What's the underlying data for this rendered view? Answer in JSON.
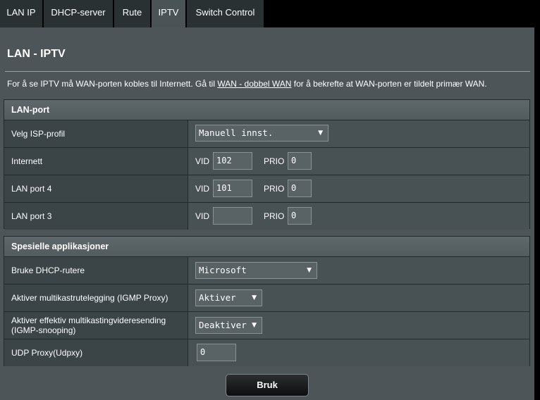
{
  "tabs": [
    "LAN IP",
    "DHCP-server",
    "Rute",
    "IPTV",
    "Switch Control"
  ],
  "page_title": "LAN - IPTV",
  "intro": {
    "before": "For å se IPTV må WAN-porten kobles til Internett. Gå til ",
    "link": "WAN - dobbel WAN",
    "after": " for å bekrefte at WAN-porten er tildelt primær WAN."
  },
  "lan_port": {
    "header": "LAN-port",
    "isp_profile_label": "Velg ISP-profil",
    "isp_profile_value": "Manuell innst.",
    "vid_label": "VID",
    "prio_label": "PRIO",
    "rows": [
      {
        "label": "Internett",
        "vid": "102",
        "prio": "0"
      },
      {
        "label": "LAN port 4",
        "vid": "101",
        "prio": "0"
      },
      {
        "label": "LAN port 3",
        "vid": "",
        "prio": "0"
      }
    ]
  },
  "special": {
    "header": "Spesielle applikasjoner",
    "dhcp_label": "Bruke DHCP-rutere",
    "dhcp_value": "Microsoft",
    "igmp_proxy_label": "Aktiver multikastrutelegging (IGMP Proxy)",
    "igmp_proxy_value": "Aktiver",
    "igmp_snoop_label_1": "Aktiver effektiv multikastingvideresending",
    "igmp_snoop_label_2": "(IGMP-snooping)",
    "igmp_snoop_value": "Deaktiver",
    "udp_label": "UDP Proxy(Udpxy)",
    "udp_value": "0"
  },
  "apply_button": "Bruk",
  "icons": {
    "dropdown": "▼"
  }
}
